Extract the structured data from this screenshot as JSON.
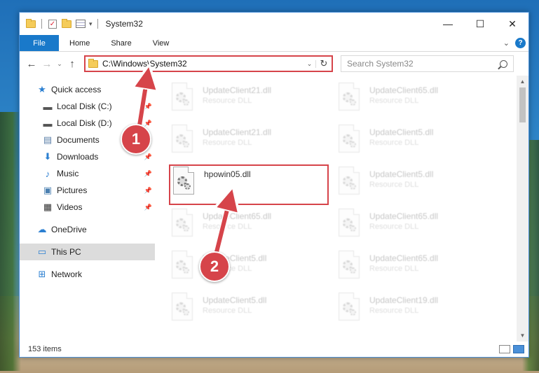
{
  "window": {
    "title": "System32"
  },
  "window_controls": {
    "minimize": "—",
    "maximize": "☐",
    "close": "✕"
  },
  "ribbon": {
    "tabs": [
      "File",
      "Home",
      "Share",
      "View"
    ]
  },
  "nav": {
    "back": "←",
    "forward": "→",
    "recent": "⌄",
    "up": "↑"
  },
  "address": {
    "path": "C:\\Windows\\System32"
  },
  "search": {
    "placeholder": "Search System32"
  },
  "sidebar": {
    "items": [
      {
        "label": "Quick access",
        "icon": "star-icon"
      },
      {
        "label": "Local Disk (C:)",
        "icon": "drive-icon",
        "pinned": true
      },
      {
        "label": "Local Disk (D:)",
        "icon": "drive-icon",
        "pinned": true
      },
      {
        "label": "Documents",
        "icon": "documents-icon",
        "pinned": true
      },
      {
        "label": "Downloads",
        "icon": "download-icon",
        "pinned": true
      },
      {
        "label": "Music",
        "icon": "music-icon",
        "pinned": true
      },
      {
        "label": "Pictures",
        "icon": "pictures-icon",
        "pinned": true
      },
      {
        "label": "Videos",
        "icon": "videos-icon",
        "pinned": true
      },
      {
        "label": "OneDrive",
        "icon": "cloud-icon"
      },
      {
        "label": "This PC",
        "icon": "pc-icon",
        "selected": true
      },
      {
        "label": "Network",
        "icon": "network-icon"
      }
    ]
  },
  "files": [
    {
      "name": "UpdateClient21.dll",
      "type": "Resource DLL"
    },
    {
      "name": "UpdateClient65.dll",
      "type": "Resource DLL"
    },
    {
      "name": "UpdateClient21.dll",
      "type": "Resource DLL"
    },
    {
      "name": "UpdateClient5.dll",
      "type": "Resource DLL"
    },
    {
      "name": "hpowin05.dll",
      "type": ""
    },
    {
      "name": "UpdateClient5.dll",
      "type": "Resource DLL"
    },
    {
      "name": "UpdateClient65.dll",
      "type": "Resource DLL"
    },
    {
      "name": "UpdateClient65.dll",
      "type": "Resource DLL"
    },
    {
      "name": "UpdateClient5.dll",
      "type": "Resource DLL"
    },
    {
      "name": "UpdateClient65.dll",
      "type": "Resource DLL"
    },
    {
      "name": "UpdateClient5.dll",
      "type": "Resource DLL"
    },
    {
      "name": "UpdateClient19.dll",
      "type": "Resource DLL"
    }
  ],
  "status": {
    "item_count": "153 items"
  },
  "callouts": [
    "1",
    "2"
  ],
  "colors": {
    "accent": "#1979ca",
    "highlight": "#d6444a"
  }
}
